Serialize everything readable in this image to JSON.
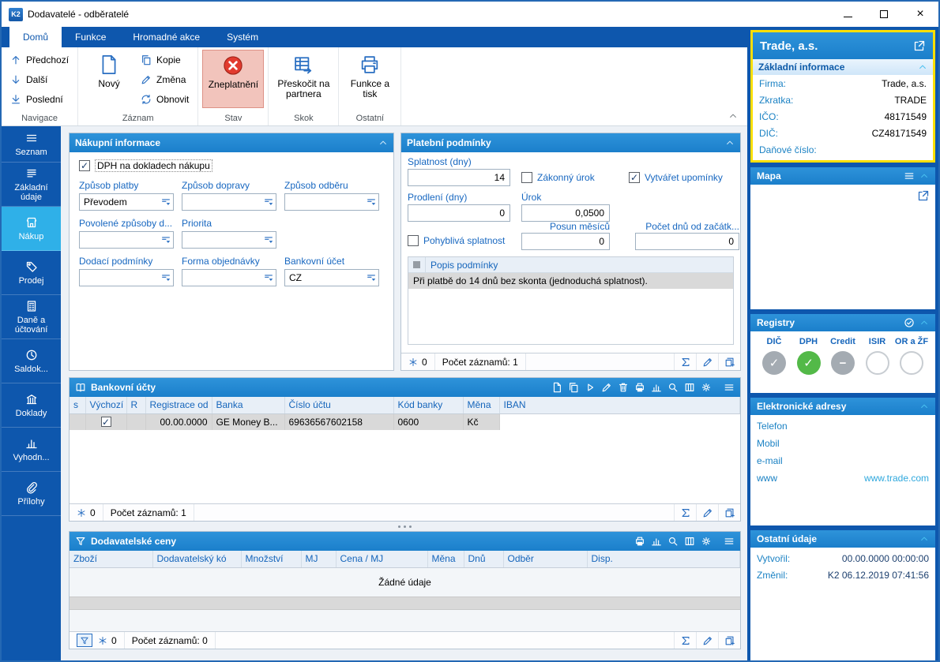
{
  "window": {
    "title": "Dodavatelé - odběratelé",
    "app_badge": "K2"
  },
  "colors": {
    "ribbon_blue": "#0e57ad",
    "panel_header_blue": "#1b7fcb",
    "active_sidebar_cyan": "#2fb0e8",
    "label_blue": "#1767c0",
    "highlight_yellow": "#ffdf00",
    "link_teal": "#2fa8dd",
    "registry_green": "#53b948",
    "registry_gray": "#a4abb2",
    "selected_row_gray": "#d9d9d9",
    "invalid_button_red": "#e23a2e"
  },
  "ribbon": {
    "tabs": [
      {
        "label": "Domů",
        "active": true
      },
      {
        "label": "Funkce",
        "active": false
      },
      {
        "label": "Hromadné akce",
        "active": false
      },
      {
        "label": "Systém",
        "active": false
      }
    ],
    "groups": [
      {
        "label": "Navigace",
        "items": [
          {
            "label": "Předchozí"
          },
          {
            "label": "Další"
          },
          {
            "label": "Poslední"
          }
        ]
      },
      {
        "label": "Záznam",
        "big": {
          "label": "Nový"
        },
        "items": [
          {
            "label": "Kopie"
          },
          {
            "label": "Změna"
          },
          {
            "label": "Obnovit"
          }
        ]
      },
      {
        "label": "Stav",
        "big": {
          "label": "Zneplatnění",
          "selected": true
        }
      },
      {
        "label": "Skok",
        "big": {
          "label": "Přeskočit na partnera"
        }
      },
      {
        "label": "Ostatní",
        "big": {
          "label": "Funkce a tisk"
        }
      }
    ]
  },
  "sidebar": {
    "items": [
      {
        "label": "Seznam",
        "active": false
      },
      {
        "label": "Základní údaje",
        "active": false
      },
      {
        "label": "Nákup",
        "active": true
      },
      {
        "label": "Prodej",
        "active": false
      },
      {
        "label": "Daně a účtování",
        "active": false
      },
      {
        "label": "Saldok...",
        "active": false
      },
      {
        "label": "Doklady",
        "active": false
      },
      {
        "label": "Vyhodn...",
        "active": false
      },
      {
        "label": "Přílohy",
        "active": false
      }
    ]
  },
  "purchase_info": {
    "title": "Nákupní informace",
    "dph_checkbox": {
      "label": "DPH na dokladech nákupu",
      "checked": true
    },
    "fields": {
      "zpusob_platby": {
        "label": "Způsob platby",
        "value": "Převodem"
      },
      "zpusob_dopravy": {
        "label": "Způsob dopravy",
        "value": ""
      },
      "zpusob_odberu": {
        "label": "Způsob odběru",
        "value": ""
      },
      "povolene_zpusoby": {
        "label": "Povolené způsoby d...",
        "value": ""
      },
      "priorita": {
        "label": "Priorita",
        "value": ""
      },
      "dodaci_podminky": {
        "label": "Dodací podmínky",
        "value": ""
      },
      "forma_objednavky": {
        "label": "Forma objednávky",
        "value": ""
      },
      "bankovni_ucet": {
        "label": "Bankovní účet",
        "value": "CZ"
      }
    }
  },
  "payment_terms": {
    "title": "Platební podmínky",
    "splatnost": {
      "label": "Splatnost (dny)",
      "value": "14"
    },
    "zakonny_urok": {
      "label": "Zákonný úrok",
      "checked": false
    },
    "vytvaret_upominky": {
      "label": "Vytvářet upomínky",
      "checked": true
    },
    "prodleni": {
      "label": "Prodlení (dny)",
      "value": "0"
    },
    "urok": {
      "label": "Úrok",
      "value": "0,0500"
    },
    "pohybliva_splatnost": {
      "label": "Pohyblivá splatnost",
      "checked": false
    },
    "posun_mesicu": {
      "label": "Posun měsíců",
      "value": "0"
    },
    "pocet_dnu": {
      "label": "Počet dnů od začátk...",
      "value": "0"
    },
    "grid": {
      "header": "Popis podmínky",
      "rows": [
        "Při platbě do 14 dnů bez skonta (jednoduchá splatnost)."
      ]
    },
    "footer": {
      "flake": "0",
      "records": "Počet záznamů: 1"
    }
  },
  "bank_accounts": {
    "title": "Bankovní účty",
    "columns": [
      "s",
      "Výchozí",
      "R",
      "Registrace od",
      "Banka",
      "Číslo účtu",
      "Kód banky",
      "Měna",
      "IBAN"
    ],
    "rows": [
      {
        "s": "",
        "vychozi": true,
        "r": "",
        "registrace_od": "00.00.0000",
        "banka": "GE Money B...",
        "cislo_uctu": "69636567602158",
        "kod_banky": "0600",
        "mena": "Kč",
        "iban": ""
      }
    ],
    "footer": {
      "flake": "0",
      "records": "Počet záznamů: 1"
    }
  },
  "supplier_prices": {
    "title": "Dodavatelské ceny",
    "columns": [
      "Zboží",
      "Dodavatelský kó",
      "Množství",
      "MJ",
      "Cena / MJ",
      "Měna",
      "Dnů",
      "Odběr",
      "Disp."
    ],
    "empty_text": "Žádné údaje",
    "footer": {
      "flake": "0",
      "records": "Počet záznamů: 0"
    }
  },
  "partner": {
    "name": "Trade, a.s.",
    "basic_info": {
      "title": "Základní informace",
      "rows": [
        {
          "label": "Firma:",
          "value": "Trade, a.s."
        },
        {
          "label": "Zkratka:",
          "value": "TRADE"
        },
        {
          "label": "IČO:",
          "value": "48171549"
        },
        {
          "label": "DIČ:",
          "value": "CZ48171549"
        },
        {
          "label": "Daňové číslo:",
          "value": ""
        }
      ]
    },
    "map": {
      "title": "Mapa"
    },
    "registry": {
      "title": "Registry",
      "items": [
        {
          "label": "DIČ",
          "state": "check-gray"
        },
        {
          "label": "DPH",
          "state": "check-green"
        },
        {
          "label": "Credit",
          "state": "dash-gray"
        },
        {
          "label": "ISIR",
          "state": "empty"
        },
        {
          "label": "OR a ŽF",
          "state": "empty"
        }
      ]
    },
    "addresses": {
      "title": "Elektronické adresy",
      "rows": [
        {
          "label": "Telefon",
          "value": ""
        },
        {
          "label": "Mobil",
          "value": ""
        },
        {
          "label": "e-mail",
          "value": ""
        },
        {
          "label": "www",
          "value": "www.trade.com"
        }
      ]
    },
    "other": {
      "title": "Ostatní údaje",
      "rows": [
        {
          "label": "Vytvořil:",
          "value": "00.00.0000 00:00:00"
        },
        {
          "label": "Změnil:",
          "value": "K2 06.12.2019 07:41:56"
        }
      ]
    }
  }
}
